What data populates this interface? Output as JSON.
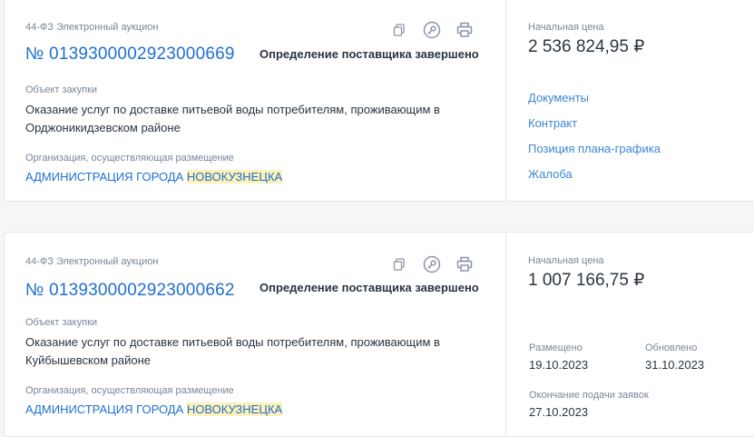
{
  "cards": [
    {
      "law": "44-ФЗ Электронный аукцион",
      "number": "№ 0139300002923000669",
      "status": "Определение поставщика завершено",
      "object_label": "Объект закупки",
      "object_text": "Оказание услуг по доставке питьевой воды потребителям, проживающим в Орджоникидзевском районе",
      "org_label": "Организация, осуществляющая размещение",
      "org_name_part1": "АДМИНИСТРАЦИЯ ГОРОДА ",
      "org_name_highlight": "НОВОКУЗНЕЦКА",
      "price_label": "Начальная цена",
      "price": "2 536 824,95 ₽",
      "links": [
        "Документы",
        "Контракт",
        "Позиция плана-графика",
        "Жалоба"
      ]
    },
    {
      "law": "44-ФЗ Электронный аукцион",
      "number": "№ 0139300002923000662",
      "status": "Определение поставщика завершено",
      "object_label": "Объект закупки",
      "object_text": "Оказание услуг по доставке питьевой воды потребителям, проживающим в Куйбышевском районе",
      "org_label": "Организация, осуществляющая размещение",
      "org_name_part1": "АДМИНИСТРАЦИЯ ГОРОДА ",
      "org_name_highlight": "НОВОКУЗНЕЦКА",
      "price_label": "Начальная цена",
      "price": "1 007 166,75 ₽",
      "placed_label": "Размещено",
      "placed_date": "19.10.2023",
      "updated_label": "Обновлено",
      "updated_date": "31.10.2023",
      "deadline_label": "Окончание подачи заявок",
      "deadline_date": "27.10.2023"
    }
  ],
  "icons": [
    "copy-icon",
    "key-icon",
    "print-icon"
  ],
  "colors": {
    "link": "#1f6fd1",
    "highlight": "#fdf1b8",
    "muted": "#7a8597"
  }
}
